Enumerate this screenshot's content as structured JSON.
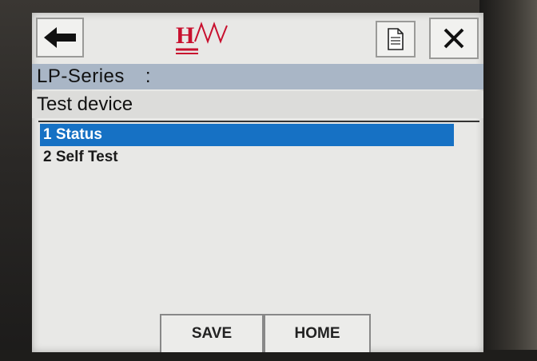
{
  "header": {
    "logo_text": "HW",
    "title": "LP-Series",
    "title_separator": ":",
    "subtitle": "Test device"
  },
  "toolbar": {
    "back_icon": "arrow-left-icon",
    "doc_icon": "document-icon",
    "close_icon": "close-icon"
  },
  "menu": {
    "items": [
      {
        "label": "1 Status",
        "selected": true
      },
      {
        "label": "2 Self Test",
        "selected": false
      }
    ]
  },
  "footer": {
    "save_label": "SAVE",
    "home_label": "HOME"
  },
  "colors": {
    "selection": "#1671c4",
    "title_band": "#a9b6c6",
    "logo_red": "#c8102e"
  }
}
